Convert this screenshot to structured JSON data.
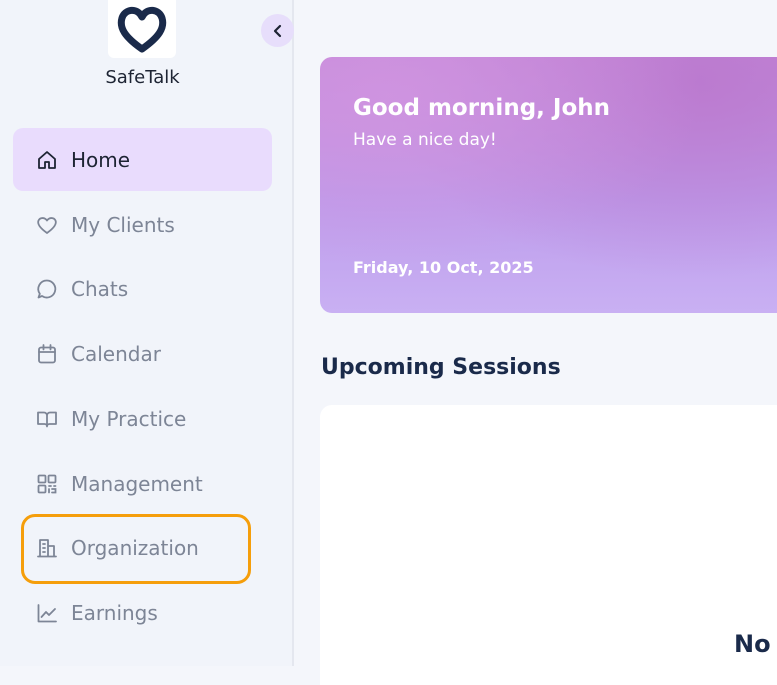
{
  "app": {
    "brand": "SafeTalk"
  },
  "colors": {
    "accent": "#e9dcfd",
    "highlight": "#f59e0b",
    "heading": "#1a2a4a",
    "logo": "#1a2a4a"
  },
  "sidebar": {
    "collapse_icon": "chevron-left-icon",
    "items": [
      {
        "label": "Home",
        "icon": "home-icon",
        "active": true
      },
      {
        "label": "My Clients",
        "icon": "heart-icon"
      },
      {
        "label": "Chats",
        "icon": "chat-bubble-icon"
      },
      {
        "label": "Calendar",
        "icon": "calendar-icon"
      },
      {
        "label": "My Practice",
        "icon": "book-open-icon"
      },
      {
        "label": "Management",
        "icon": "qr-code-icon"
      },
      {
        "label": "Organization",
        "icon": "building-icon",
        "highlighted": true
      },
      {
        "label": "Earnings",
        "icon": "chart-line-icon"
      }
    ]
  },
  "hero": {
    "greeting": "Good morning, John",
    "subtitle": "Have a nice day!",
    "date": "Friday, 10 Oct, 2025"
  },
  "sessions": {
    "title": "Upcoming Sessions",
    "empty_text": "No"
  }
}
